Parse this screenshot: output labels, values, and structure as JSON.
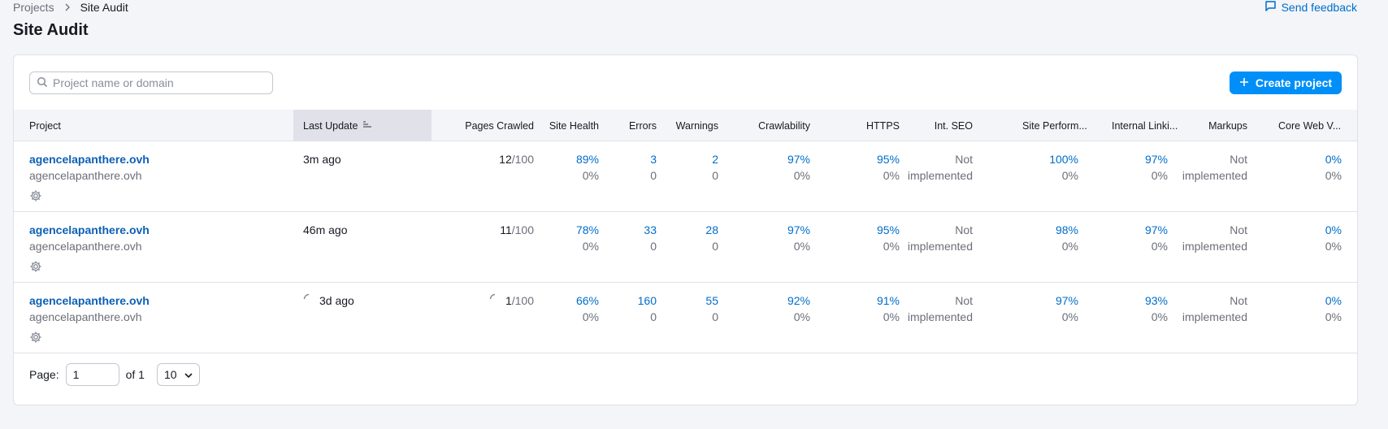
{
  "breadcrumb": {
    "parent": "Projects",
    "current": "Site Audit"
  },
  "page_title": "Site Audit",
  "feedback_label": "Send feedback",
  "search": {
    "placeholder": "Project name or domain",
    "value": ""
  },
  "create_button": "Create project",
  "columns": {
    "project": "Project",
    "last_update": "Last Update",
    "pages_crawled": "Pages Crawled",
    "site_health": "Site Health",
    "errors": "Errors",
    "warnings": "Warnings",
    "crawlability": "Crawlability",
    "https": "HTTPS",
    "int_seo": "Int. SEO",
    "site_performance": "Site Perform...",
    "internal_linking": "Internal Linki...",
    "markups": "Markups",
    "core_web_vitals": "Core Web V..."
  },
  "rows": [
    {
      "name": "agencelapanthere.ovh",
      "domain": "agencelapanthere.ovh",
      "last_update": "3m ago",
      "pages_crawled": "12",
      "pages_limit": "/100",
      "site_health": "89%",
      "site_health_delta": "0%",
      "errors": "3",
      "errors_delta": "0",
      "warnings": "2",
      "warnings_delta": "0",
      "crawlability": "97%",
      "crawlability_delta": "0%",
      "https": "95%",
      "https_delta": "0%",
      "int_seo_1": "Not",
      "int_seo_2": "implemented",
      "site_performance": "100%",
      "site_performance_delta": "0%",
      "internal_linking": "97%",
      "internal_linking_delta": "0%",
      "markups_1": "Not",
      "markups_2": "implemented",
      "core_web_vitals": "0%",
      "core_web_vitals_delta": "0%"
    },
    {
      "name": "agencelapanthere.ovh",
      "domain": "agencelapanthere.ovh",
      "last_update": "46m ago",
      "pages_crawled": "11",
      "pages_limit": "/100",
      "site_health": "78%",
      "site_health_delta": "0%",
      "errors": "33",
      "errors_delta": "0",
      "warnings": "28",
      "warnings_delta": "0",
      "crawlability": "97%",
      "crawlability_delta": "0%",
      "https": "95%",
      "https_delta": "0%",
      "int_seo_1": "Not",
      "int_seo_2": "implemented",
      "site_performance": "98%",
      "site_performance_delta": "0%",
      "internal_linking": "97%",
      "internal_linking_delta": "0%",
      "markups_1": "Not",
      "markups_2": "implemented",
      "core_web_vitals": "0%",
      "core_web_vitals_delta": "0%"
    },
    {
      "name": "agencelapanthere.ovh",
      "domain": "agencelapanthere.ovh",
      "last_update": "3d ago",
      "pages_crawled": "1",
      "pages_limit": "/100",
      "site_health": "66%",
      "site_health_delta": "0%",
      "errors": "160",
      "errors_delta": "0",
      "warnings": "55",
      "warnings_delta": "0",
      "crawlability": "92%",
      "crawlability_delta": "0%",
      "https": "91%",
      "https_delta": "0%",
      "int_seo_1": "Not",
      "int_seo_2": "implemented",
      "site_performance": "97%",
      "site_performance_delta": "0%",
      "internal_linking": "93%",
      "internal_linking_delta": "0%",
      "markups_1": "Not",
      "markups_2": "implemented",
      "core_web_vitals": "0%",
      "core_web_vitals_delta": "0%"
    }
  ],
  "pagination": {
    "page_label": "Page:",
    "page_value": "1",
    "of_label": "of 1",
    "per_page": "10"
  },
  "colors": {
    "accent": "#008ff8",
    "link": "#006dca",
    "project_link": "#0d60b5"
  }
}
